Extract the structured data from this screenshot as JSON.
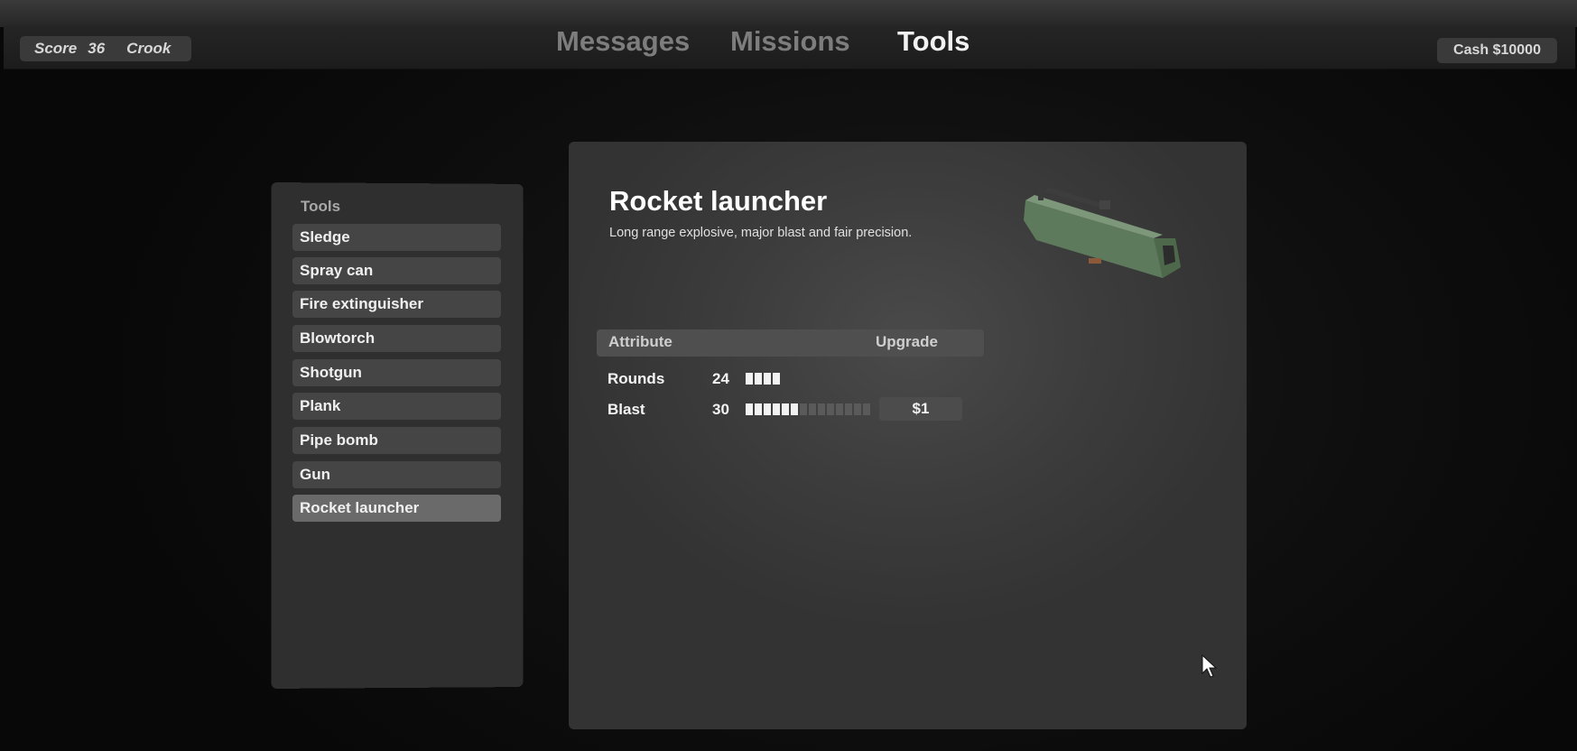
{
  "hud": {
    "score_label": "Score",
    "score_value": "36",
    "rank": "Crook",
    "cash": "Cash $10000"
  },
  "nav": {
    "tabs": [
      {
        "label": "Messages",
        "active": false
      },
      {
        "label": "Missions",
        "active": false
      },
      {
        "label": "Tools",
        "active": true
      }
    ]
  },
  "tools_list": {
    "header": "Tools",
    "items": [
      {
        "label": "Sledge"
      },
      {
        "label": "Spray can"
      },
      {
        "label": "Fire extinguisher"
      },
      {
        "label": "Blowtorch"
      },
      {
        "label": "Shotgun"
      },
      {
        "label": "Plank"
      },
      {
        "label": "Pipe bomb"
      },
      {
        "label": "Gun"
      },
      {
        "label": "Rocket launcher",
        "selected": true
      }
    ]
  },
  "detail": {
    "title": "Rocket launcher",
    "description": "Long range explosive, major blast and fair precision.",
    "attr_header": "Attribute",
    "upgrade_header": "Upgrade",
    "attributes": [
      {
        "name": "Rounds",
        "value": "24",
        "level": 4,
        "max": 4
      },
      {
        "name": "Blast",
        "value": "30",
        "level": 6,
        "max": 14,
        "upgrade_price": "$1"
      }
    ]
  },
  "colors": {
    "accent": "#ffffff",
    "panel": "#2f2f2f",
    "selected_item": "#6a6a6a",
    "weapon_green": "#5e7a5c"
  },
  "icons": {
    "weapon_preview": "rocket-launcher-model",
    "cursor": "pointer-arrow-icon"
  }
}
